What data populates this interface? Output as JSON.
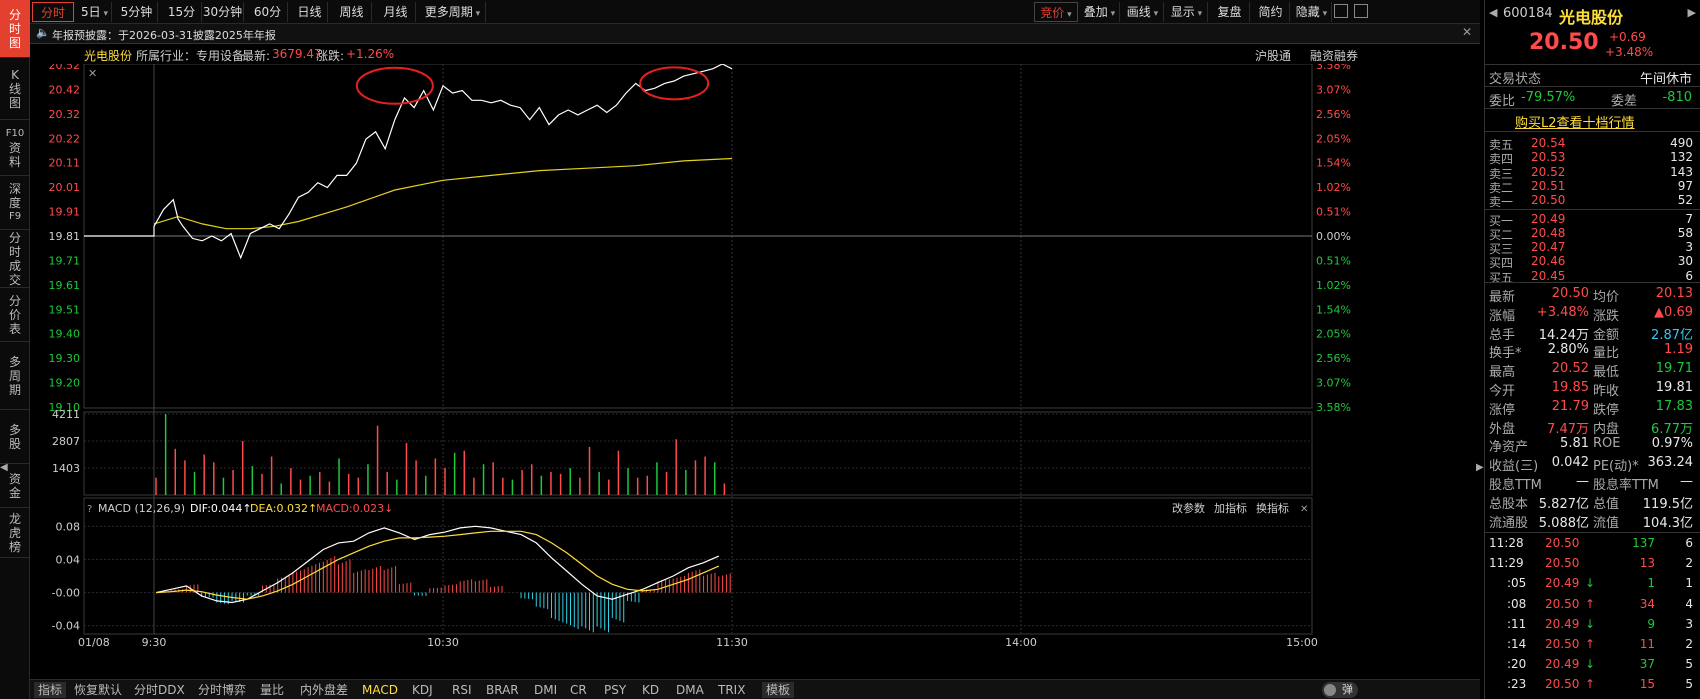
{
  "sidebar": {
    "items": [
      {
        "chars": [
          "分",
          "时",
          "图"
        ],
        "active": true
      },
      {
        "chars": [
          "K",
          "线",
          "图"
        ],
        "active": false
      },
      {
        "chars": [
          "F10",
          "资",
          "料"
        ],
        "active": false
      },
      {
        "chars": [
          "深",
          "度",
          "F9"
        ],
        "active": false
      },
      {
        "chars": [
          "分",
          "时",
          "成",
          "交"
        ],
        "active": false
      },
      {
        "chars": [
          "分",
          "价",
          "表"
        ],
        "active": false
      },
      {
        "chars": [
          "多",
          "周",
          "期"
        ],
        "active": false
      },
      {
        "chars": [
          "多",
          "股"
        ],
        "active": false
      },
      {
        "chars": [
          "资",
          "金"
        ],
        "active": false
      },
      {
        "chars": [
          "龙",
          "虎",
          "榜"
        ],
        "active": false
      }
    ]
  },
  "toolbar": {
    "periods": [
      "分时",
      "5日",
      "5分钟",
      "15分钟",
      "30分钟",
      "60分钟",
      "日线",
      "周线",
      "月线",
      "更多周期"
    ],
    "right_tools": [
      "竞价",
      "叠加",
      "画线",
      "显示",
      "复盘",
      "简约",
      "隐藏"
    ]
  },
  "notice": {
    "icon": "speaker-icon",
    "text": "年报预披露：于2026-03-31披露2025年年报"
  },
  "chart_header": {
    "name": "光电股份",
    "industry_label": "所属行业：专用设备",
    "latest_label": "最新:",
    "latest_value": "3679.47",
    "change_label": "涨跌:",
    "change_value": "+1.26%",
    "links": [
      "沪股通",
      "融资融券"
    ]
  },
  "macd_header": {
    "name": "MACD (12,26,9)",
    "dif": "DIF:0.044↑",
    "dea": "DEA:0.032↑",
    "macd": "MACD:0.023↓",
    "actions": [
      "改参数",
      "加指标",
      "换指标"
    ]
  },
  "bottom_tabs": [
    "指标",
    "恢复默认",
    "分时DDX",
    "分时博弈",
    "量比",
    "内外盘差",
    "MACD",
    "KDJ",
    "RSI",
    "BRAR",
    "DMI",
    "CR",
    "PSY",
    "KD",
    "DMA",
    "TRIX",
    "模板"
  ],
  "bottom_toggle": "弹",
  "colors": {
    "up": "#ff4b4b",
    "down": "#1ec93b",
    "avg": "#e3d31a",
    "price": "#ffffff",
    "accent": "#e3402f"
  },
  "quote": {
    "code": "600184",
    "name": "光电股份",
    "price": "20.50",
    "change": "+0.69",
    "change_pct": "+3.48%",
    "status_label": "交易状态",
    "status_value": "午间休市",
    "wb_label": "委比",
    "wb_value": "-79.57%",
    "wc_label": "委差",
    "wc_value": "-810",
    "l2_link": "购买L2查看十档行情",
    "sells": [
      {
        "label": "卖五",
        "price": "20.54",
        "vol": "490"
      },
      {
        "label": "卖四",
        "price": "20.53",
        "vol": "132"
      },
      {
        "label": "卖三",
        "price": "20.52",
        "vol": "143"
      },
      {
        "label": "卖二",
        "price": "20.51",
        "vol": "97"
      },
      {
        "label": "卖一",
        "price": "20.50",
        "vol": "52"
      }
    ],
    "buys": [
      {
        "label": "买一",
        "price": "20.49",
        "vol": "7"
      },
      {
        "label": "买二",
        "price": "20.48",
        "vol": "58"
      },
      {
        "label": "买三",
        "price": "20.47",
        "vol": "3"
      },
      {
        "label": "买四",
        "price": "20.46",
        "vol": "30"
      },
      {
        "label": "买五",
        "price": "20.45",
        "vol": "6"
      }
    ],
    "stats": [
      {
        "l1": "最新",
        "v1": "20.50",
        "c1": "red",
        "l2": "均价",
        "v2": "20.13",
        "c2": "red"
      },
      {
        "l1": "涨幅",
        "v1": "+3.48%",
        "c1": "red",
        "l2": "涨跌",
        "v2": "▲0.69",
        "c2": "red"
      },
      {
        "l1": "总手",
        "v1": "14.24万",
        "c1": "wht",
        "l2": "金额",
        "v2": "2.87亿",
        "c2": "cyan"
      },
      {
        "l1": "换手*",
        "v1": "2.80%",
        "c1": "wht",
        "l2": "量比",
        "v2": "1.19",
        "c2": "red"
      },
      {
        "l1": "最高",
        "v1": "20.52",
        "c1": "red",
        "l2": "最低",
        "v2": "19.71",
        "c2": "grn"
      },
      {
        "l1": "今开",
        "v1": "19.85",
        "c1": "red",
        "l2": "昨收",
        "v2": "19.81",
        "c2": "wht"
      },
      {
        "l1": "涨停",
        "v1": "21.79",
        "c1": "red",
        "l2": "跌停",
        "v2": "17.83",
        "c2": "grn"
      },
      {
        "l1": "外盘",
        "v1": "7.47万",
        "c1": "red",
        "l2": "内盘",
        "v2": "6.77万",
        "c2": "grn"
      },
      {
        "l1": "净资产",
        "v1": "5.81",
        "c1": "wht",
        "l2": "ROE",
        "v2": "0.97%",
        "c2": "wht"
      },
      {
        "l1": "收益(三)",
        "v1": "0.042",
        "c1": "wht",
        "l2": "PE(动)*",
        "v2": "363.24",
        "c2": "wht"
      },
      {
        "l1": "股息TTM",
        "v1": "—",
        "c1": "wht",
        "l2": "股息率TTM",
        "v2": "—",
        "c2": "wht"
      },
      {
        "l1": "总股本",
        "v1": "5.827亿",
        "c1": "wht",
        "l2": "总值",
        "v2": "119.5亿",
        "c2": "wht"
      },
      {
        "l1": "流通股",
        "v1": "5.088亿",
        "c1": "wht",
        "l2": "流值",
        "v2": "104.3亿",
        "c2": "wht"
      }
    ],
    "ticks": [
      {
        "time": "11:28",
        "price": "20.50",
        "arrow": "",
        "vol": "137",
        "n": "6",
        "pc": "red",
        "vc": "grn"
      },
      {
        "time": "11:29",
        "price": "20.50",
        "arrow": "",
        "vol": "13",
        "n": "2",
        "pc": "red",
        "vc": "red"
      },
      {
        "time": ":05",
        "price": "20.49",
        "arrow": "↓",
        "vol": "1",
        "n": "1",
        "pc": "red",
        "vc": "grn"
      },
      {
        "time": ":08",
        "price": "20.50",
        "arrow": "↑",
        "vol": "34",
        "n": "4",
        "pc": "red",
        "vc": "red"
      },
      {
        "time": ":11",
        "price": "20.49",
        "arrow": "↓",
        "vol": "9",
        "n": "3",
        "pc": "red",
        "vc": "grn"
      },
      {
        "time": ":14",
        "price": "20.50",
        "arrow": "↑",
        "vol": "11",
        "n": "2",
        "pc": "red",
        "vc": "red"
      },
      {
        "time": ":20",
        "price": "20.49",
        "arrow": "↓",
        "vol": "37",
        "n": "5",
        "pc": "red",
        "vc": "grn"
      },
      {
        "time": ":23",
        "price": "20.50",
        "arrow": "↑",
        "vol": "15",
        "n": "5",
        "pc": "red",
        "vc": "red"
      }
    ]
  },
  "chart_data": {
    "type": "line",
    "title": "光电股份 分时",
    "prev_close": 19.81,
    "price_ticks": [
      "20.52",
      "20.42",
      "20.32",
      "20.22",
      "20.11",
      "20.01",
      "19.91",
      "19.81",
      "19.71",
      "19.61",
      "19.51",
      "19.40",
      "19.30",
      "19.20",
      "19.10"
    ],
    "pct_ticks": [
      "3.58%",
      "3.07%",
      "2.56%",
      "2.05%",
      "1.54%",
      "1.02%",
      "0.51%",
      "0.00%",
      "0.51%",
      "1.02%",
      "1.54%",
      "2.05%",
      "2.56%",
      "3.07%",
      "3.58%"
    ],
    "ylim": [
      19.1,
      20.52
    ],
    "x_ticks": [
      "01/08",
      "9:30",
      "10:30",
      "11:30",
      "14:00",
      "15:00"
    ],
    "vol_ticks": [
      "4211",
      "2807",
      "1403"
    ],
    "vol_max": 4211,
    "macd_ticks": [
      "0.08",
      "0.04",
      "-0.00",
      "-0.04"
    ],
    "macd_ylim": [
      -0.05,
      0.09
    ],
    "annotations": [
      "circle-around-10:50-peak",
      "circle-around-11:20-peak"
    ],
    "series": [
      {
        "name": "价格",
        "minutes": [
          0,
          2,
          4,
          5,
          6,
          8,
          10,
          12,
          14,
          16,
          18,
          20,
          22,
          24,
          26,
          28,
          30,
          32,
          34,
          36,
          38,
          40,
          42,
          44,
          46,
          48,
          50,
          52,
          54,
          56,
          58,
          60,
          62,
          64,
          66,
          68,
          70,
          72,
          74,
          76,
          78,
          80,
          82,
          84,
          86,
          88,
          90,
          92,
          94,
          96,
          98,
          100,
          102,
          104,
          106,
          108,
          110,
          112,
          114,
          116,
          118,
          120
        ],
        "values": [
          19.85,
          19.92,
          19.96,
          19.88,
          19.85,
          19.8,
          19.79,
          19.81,
          19.79,
          19.82,
          19.72,
          19.82,
          19.84,
          19.86,
          19.84,
          19.9,
          19.97,
          19.99,
          20.03,
          20.01,
          20.06,
          20.06,
          20.11,
          20.21,
          20.24,
          20.17,
          20.29,
          20.38,
          20.34,
          20.41,
          20.33,
          20.43,
          20.4,
          20.41,
          20.37,
          20.37,
          20.36,
          20.37,
          20.35,
          20.34,
          20.29,
          20.34,
          20.27,
          20.31,
          20.33,
          20.31,
          20.33,
          20.35,
          20.32,
          20.35,
          20.4,
          20.44,
          20.41,
          20.42,
          20.44,
          20.45,
          20.47,
          20.48,
          20.49,
          20.5,
          20.52,
          20.5
        ]
      },
      {
        "name": "均价",
        "minutes": [
          0,
          5,
          10,
          15,
          20,
          25,
          30,
          40,
          50,
          60,
          70,
          80,
          90,
          100,
          110,
          120
        ],
        "values": [
          19.86,
          19.89,
          19.86,
          19.84,
          19.84,
          19.85,
          19.87,
          19.93,
          20.0,
          20.04,
          20.06,
          20.08,
          20.09,
          20.1,
          20.12,
          20.13
        ]
      },
      {
        "name": "成交量",
        "values": [
          900,
          4211,
          2400,
          1800,
          1200,
          2100,
          1700,
          900,
          1300,
          2807,
          1500,
          1100,
          2000,
          600,
          1400,
          800,
          1000,
          1200,
          700,
          1900,
          1100,
          900,
          1600,
          3600,
          1200,
          800,
          2700,
          1800,
          1000,
          1900,
          1400,
          2200,
          2300,
          900,
          1600,
          1700,
          900,
          800,
          1300,
          1600,
          1000,
          1200,
          1100,
          1400,
          900,
          2500,
          1200,
          800,
          2300,
          1400,
          900,
          1000,
          1700,
          1200,
          2900,
          1300,
          1800,
          2000,
          1700,
          600
        ]
      },
      {
        "name": "DIF",
        "values": [
          0.0,
          0.004,
          0.008,
          -0.004,
          -0.01,
          -0.012,
          -0.008,
          0.002,
          0.012,
          0.024,
          0.038,
          0.052,
          0.06,
          0.062,
          0.072,
          0.078,
          0.072,
          0.064,
          0.07,
          0.073,
          0.078,
          0.08,
          0.078,
          0.074,
          0.07,
          0.06,
          0.042,
          0.026,
          0.01,
          -0.004,
          -0.008,
          -0.002,
          0.004,
          0.012,
          0.02,
          0.03,
          0.036,
          0.044
        ]
      },
      {
        "name": "DEA",
        "values": [
          0.0,
          0.001,
          0.003,
          0.001,
          -0.003,
          -0.006,
          -0.008,
          -0.004,
          0.002,
          0.01,
          0.02,
          0.03,
          0.04,
          0.048,
          0.056,
          0.062,
          0.066,
          0.066,
          0.067,
          0.068,
          0.07,
          0.072,
          0.074,
          0.074,
          0.074,
          0.07,
          0.06,
          0.048,
          0.034,
          0.02,
          0.01,
          0.004,
          0.002,
          0.004,
          0.01,
          0.016,
          0.024,
          0.032
        ]
      },
      {
        "name": "MACD柱",
        "values": [
          0.0,
          0.004,
          0.01,
          -0.006,
          -0.014,
          -0.012,
          -0.004,
          0.01,
          0.02,
          0.028,
          0.036,
          0.044,
          0.04,
          0.028,
          0.032,
          0.032,
          0.012,
          -0.004,
          0.006,
          0.01,
          0.016,
          0.016,
          0.008,
          0.0,
          -0.008,
          -0.02,
          -0.036,
          -0.044,
          -0.048,
          -0.048,
          -0.036,
          -0.012,
          0.004,
          0.016,
          0.02,
          0.028,
          0.024,
          0.023
        ]
      }
    ]
  }
}
